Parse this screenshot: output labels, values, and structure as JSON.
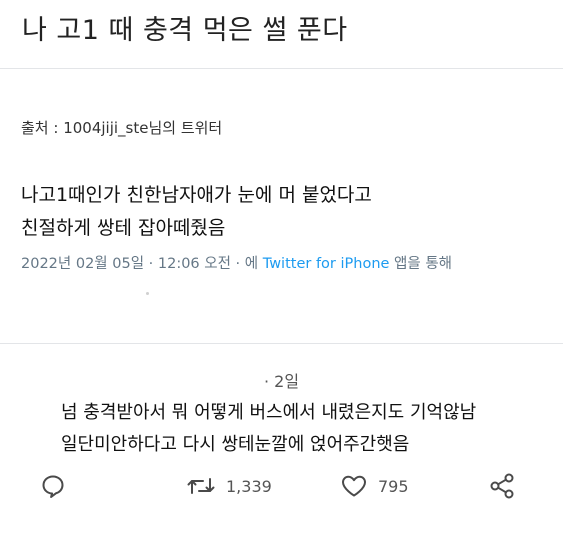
{
  "post": {
    "title": "나 고1 때 충격 먹은 썰 푼다"
  },
  "source": {
    "label": "출처 : 1004jiji_ste님의 트위터"
  },
  "tweet": {
    "line1": "나고1때인가 친한남자애가 눈에 머 붙었다고",
    "line2": "친절하게 쌍테 잡아떼줬음",
    "date": "2022년 02월 05일 · 12:06 오전 · 에",
    "via": "Twitter for iPhone",
    "via_suffix": "앱을 통해"
  },
  "reply": {
    "time": "· 2일",
    "line1": "넘 충격받아서 뭐 어떻게 버스에서 내렸은지도 기억않남",
    "line2": "일단미안하다고 다시 쌍테눈깔에 얹어주간햇음"
  },
  "actions": {
    "retweet_count": "1,339",
    "like_count": "795",
    "icons": [
      "comment-icon",
      "retweet-icon",
      "heart-icon",
      "share-icon"
    ]
  }
}
